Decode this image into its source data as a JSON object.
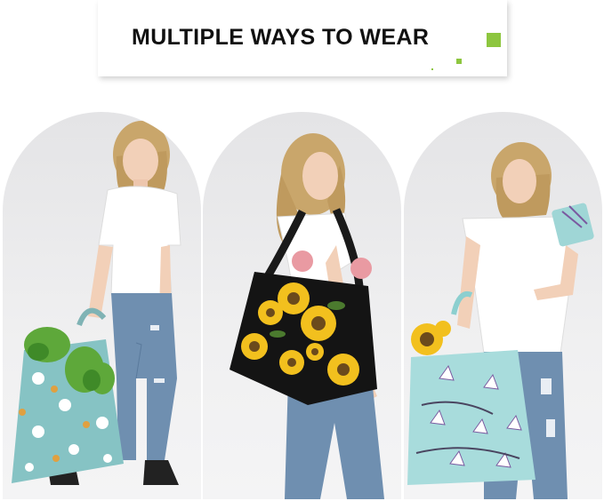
{
  "header": {
    "title": "MULTIPLE WAYS TO WEAR"
  },
  "colors": {
    "accent": "#8dc63f",
    "title_text": "#111111",
    "panel_bg": "#ececee"
  },
  "panels": [
    {
      "pose": "holding-tote-by-hand",
      "bag_pattern": "teal-with-flowers-and-vegetables"
    },
    {
      "pose": "tote-on-shoulder",
      "bag_pattern": "black-sunflowers"
    },
    {
      "pose": "tote-on-arm-holding-pouch",
      "bag_pattern": "light-blue-lilies"
    }
  ]
}
